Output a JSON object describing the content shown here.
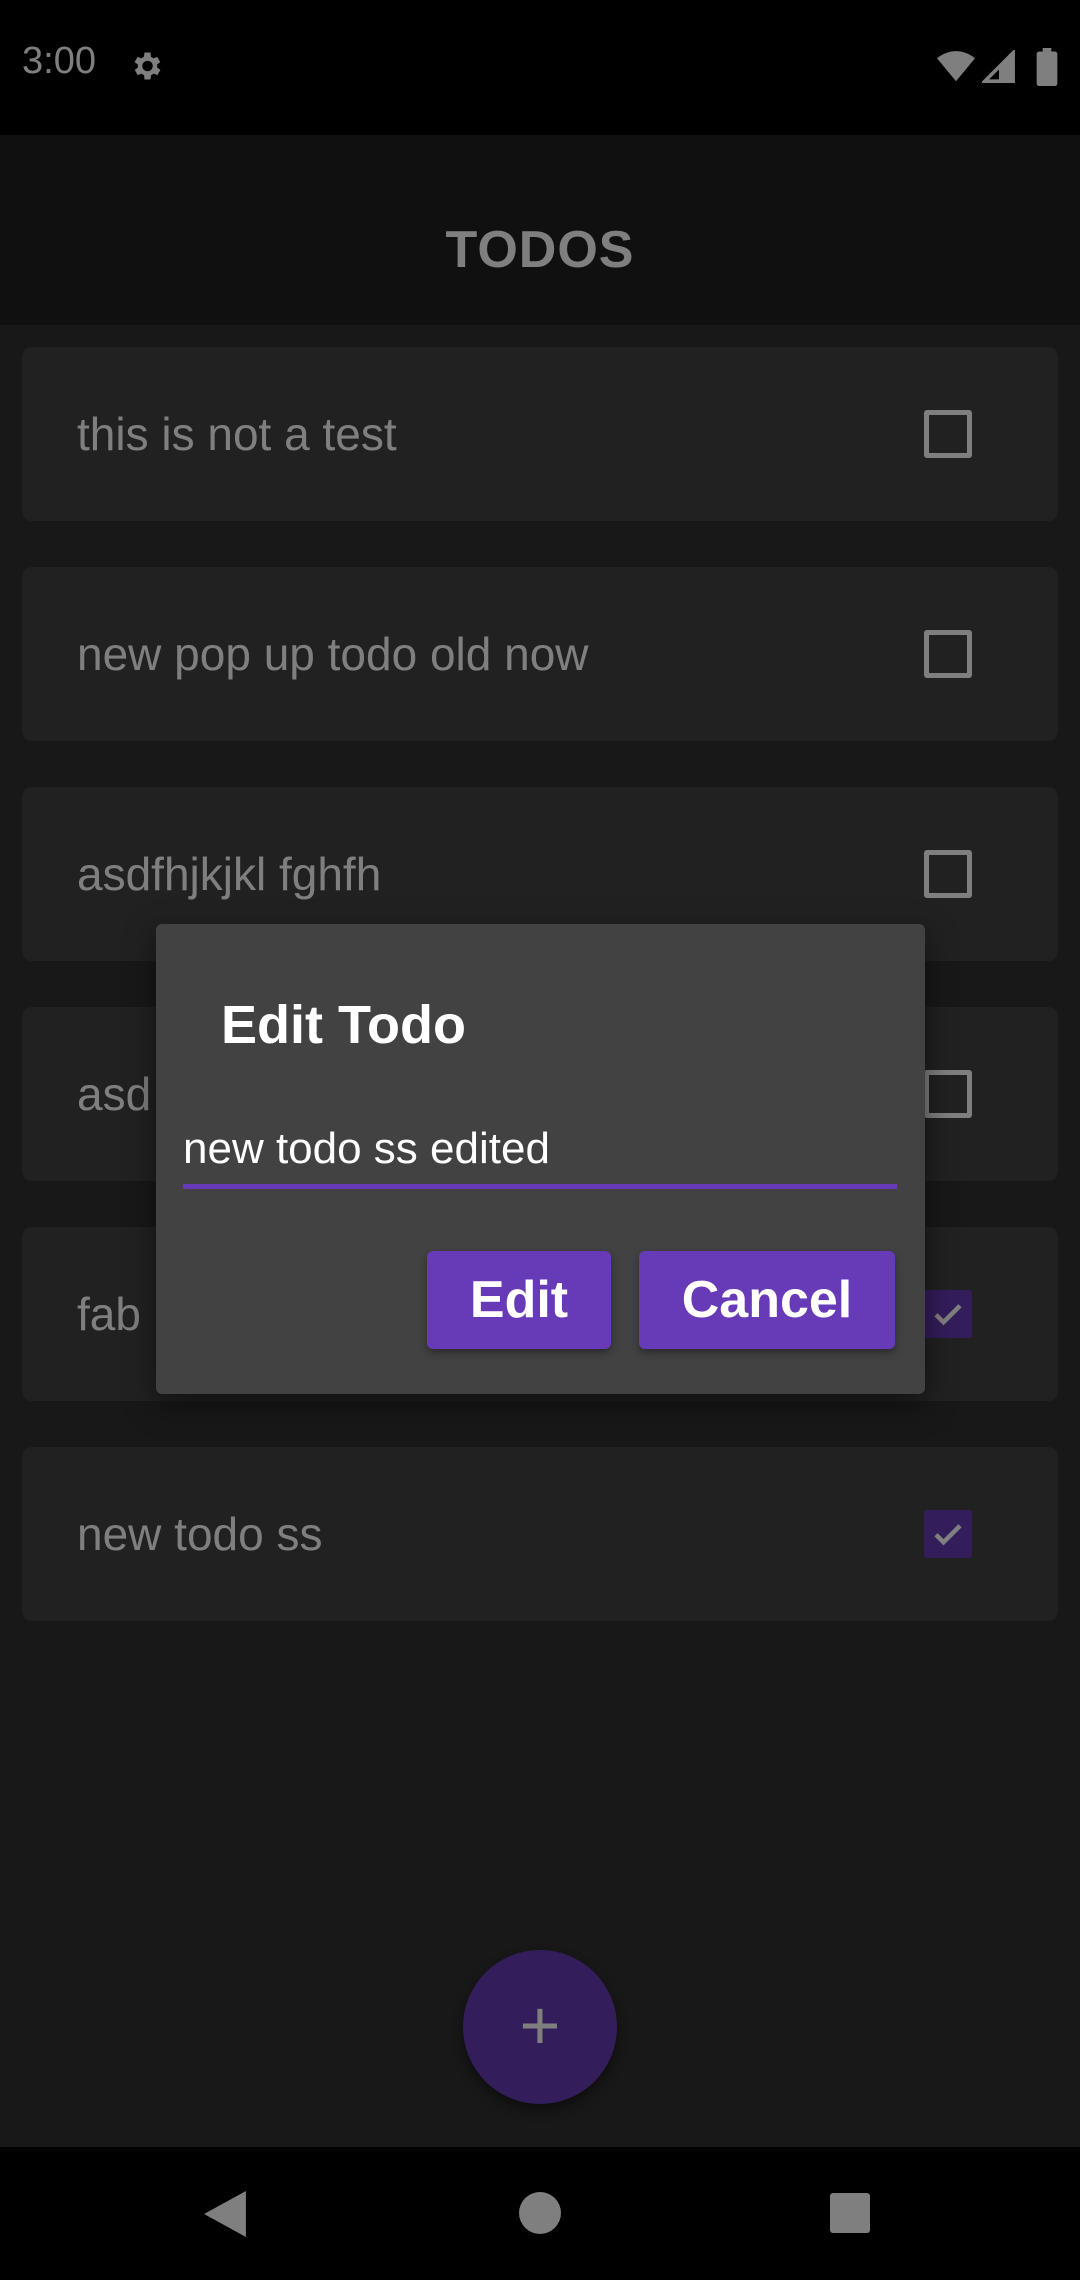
{
  "status_bar": {
    "time": "3:00",
    "icons": [
      "gear-icon",
      "wifi-icon",
      "signal-icon",
      "battery-icon"
    ]
  },
  "app_bar": {
    "title": "TODOS"
  },
  "todos": [
    {
      "text": "this is not a test",
      "checked": false
    },
    {
      "text": "new pop up todo old now",
      "checked": false
    },
    {
      "text": "asdfhjkjkl fghfh",
      "checked": false
    },
    {
      "text": "asd",
      "checked": false
    },
    {
      "text": "fab",
      "checked": true
    },
    {
      "text": "new todo ss",
      "checked": true
    }
  ],
  "fab": {
    "symbol": "+"
  },
  "dialog": {
    "title": "Edit Todo",
    "input_value": "new todo ss edited",
    "edit_label": "Edit",
    "cancel_label": "Cancel"
  },
  "colors": {
    "accent": "#673ab7",
    "background": "#303030",
    "card": "#424242",
    "app_bar": "#212121"
  }
}
